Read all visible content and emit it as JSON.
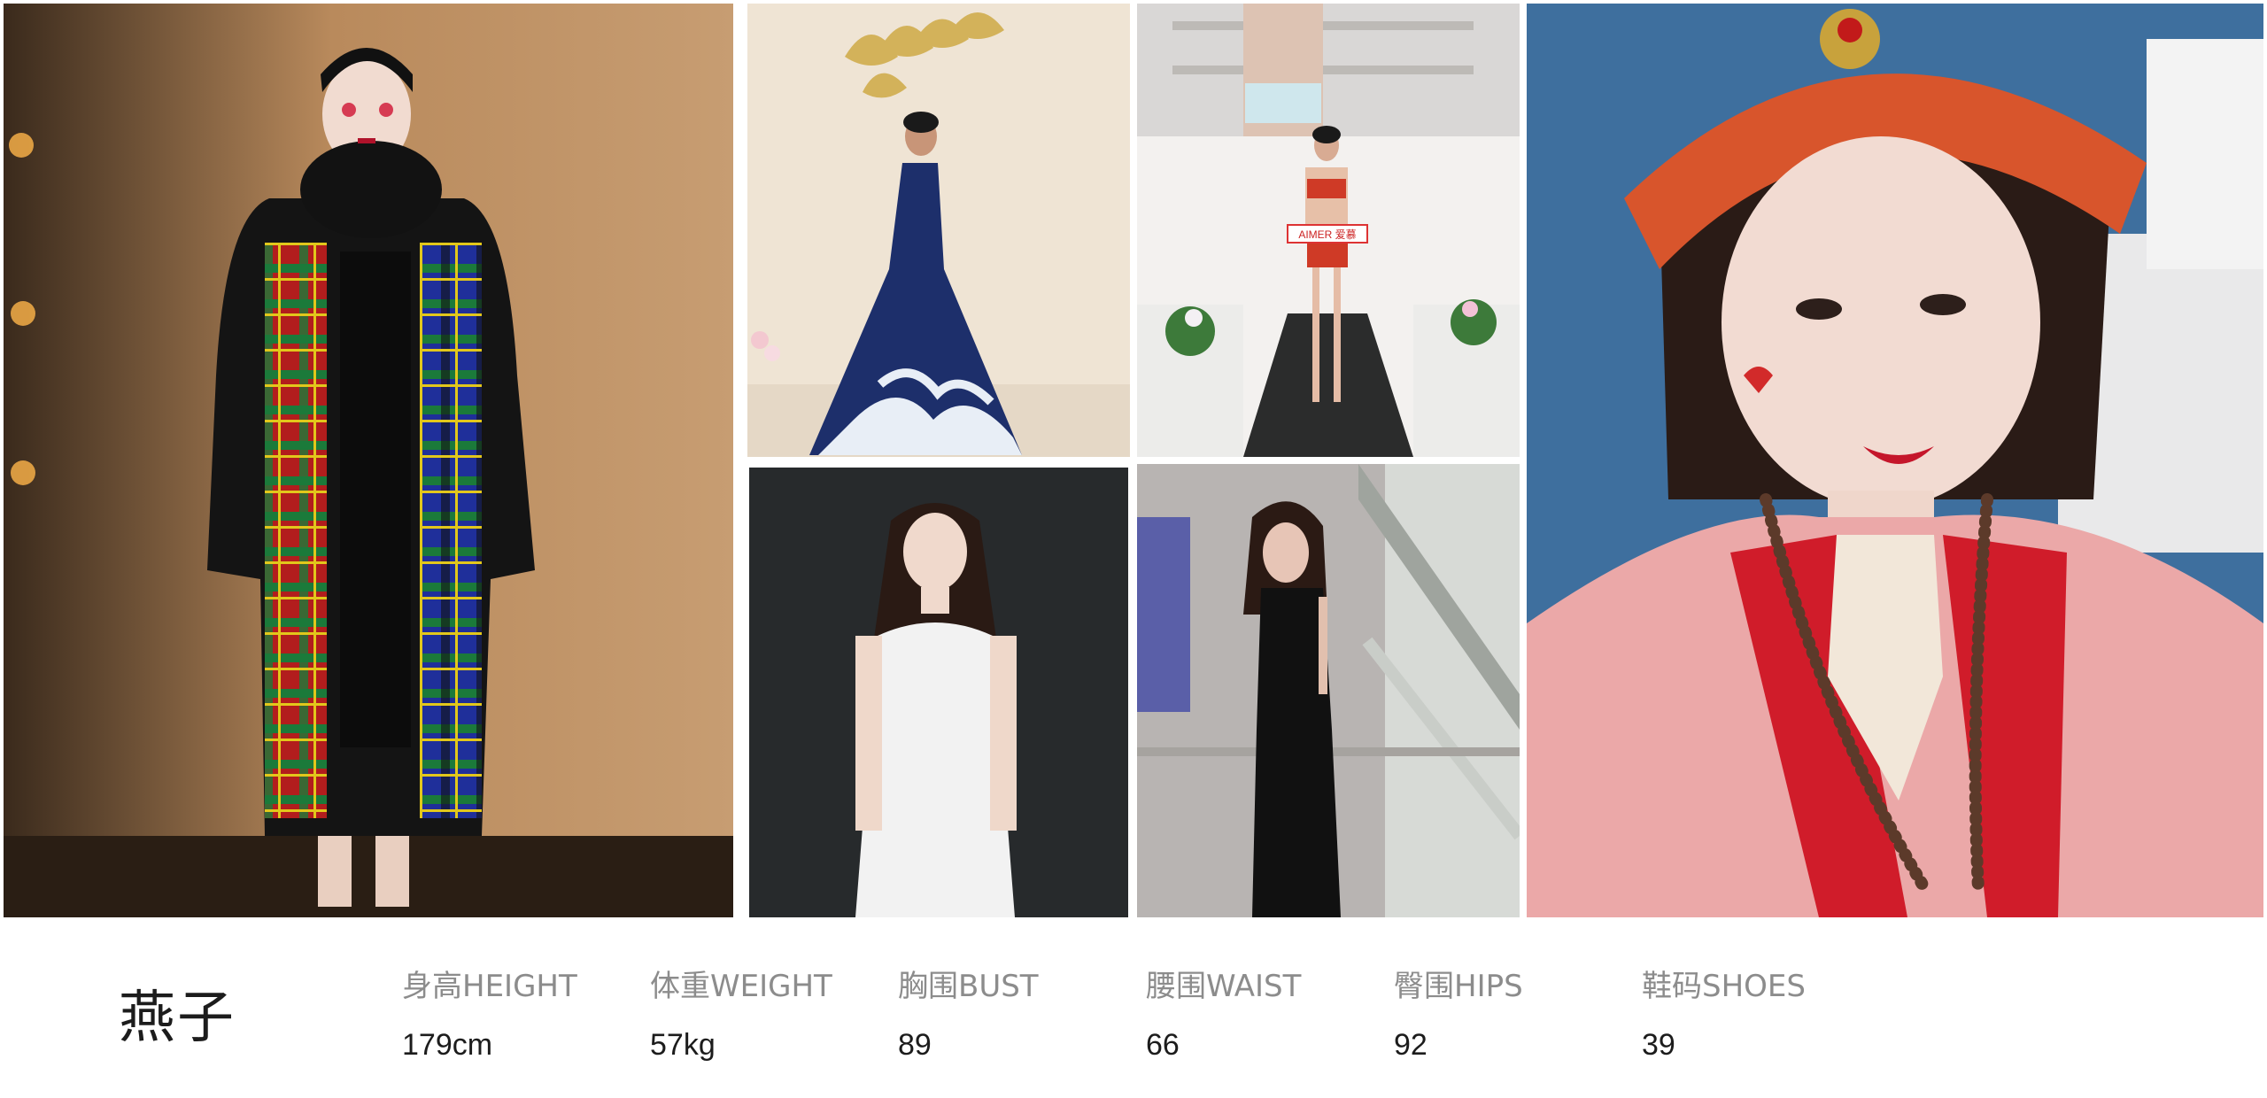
{
  "model": {
    "name": "燕子"
  },
  "stats": [
    {
      "label": "身高HEIGHT",
      "value": "179cm"
    },
    {
      "label": "体重WEIGHT",
      "value": "57kg"
    },
    {
      "label": "胸围BUST",
      "value": "89"
    },
    {
      "label": "腰围WAIST",
      "value": "66"
    },
    {
      "label": "臀围HIPS",
      "value": "92"
    },
    {
      "label": "鞋码SHOES",
      "value": "39"
    }
  ],
  "photos": [
    {
      "subject": "runway-plaid-coat-photo"
    },
    {
      "subject": "blue-wave-gown-photo"
    },
    {
      "subject": "mall-runway-red-lingerie-photo"
    },
    {
      "subject": "white-dress-studio-photo"
    },
    {
      "subject": "black-lace-dress-photo"
    },
    {
      "subject": "pink-red-outfit-selfie-photo"
    }
  ],
  "photo_signs": {
    "mall_banner_brand": "AIMER 爱慕"
  },
  "colors": {
    "name_text": "#1c1c1c",
    "label_text": "#8c8c8c",
    "value_text": "#1c1c1c",
    "background": "#ffffff"
  }
}
